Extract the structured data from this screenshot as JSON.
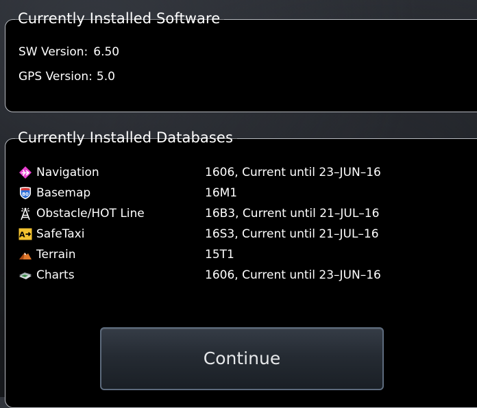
{
  "software": {
    "title": "Currently Installed Software",
    "sw_version_label": "SW Version:",
    "sw_version_value": "6.50",
    "gps_version_label": "GPS Version:",
    "gps_version_value": "5.0"
  },
  "databases": {
    "title": "Currently Installed Databases",
    "items": [
      {
        "name": "Navigation",
        "info": "1606, Current until 23–JUN–16",
        "icon": "navigation-icon"
      },
      {
        "name": "Basemap",
        "info": "16M1",
        "icon": "basemap-shield-icon"
      },
      {
        "name": "Obstacle/HOT Line",
        "info": "16B3, Current until 21–JUL–16",
        "icon": "obstacle-tower-icon"
      },
      {
        "name": "SafeTaxi",
        "info": "16S3, Current until 21–JUL–16",
        "icon": "safetaxi-icon"
      },
      {
        "name": "Terrain",
        "info": "15T1",
        "icon": "terrain-icon"
      },
      {
        "name": "Charts",
        "info": "1606, Current until 23–JUN–16",
        "icon": "charts-icon"
      }
    ]
  },
  "buttons": {
    "continue_label": "Continue"
  },
  "colors": {
    "panel_border": "#b9bcc2",
    "navigation_icon": "#e83fd0",
    "basemap_icon": "#2f6fd6",
    "safetaxi_icon": "#f2c230",
    "terrain_icon": "#e0772a",
    "button_border": "#5d6b7d"
  }
}
